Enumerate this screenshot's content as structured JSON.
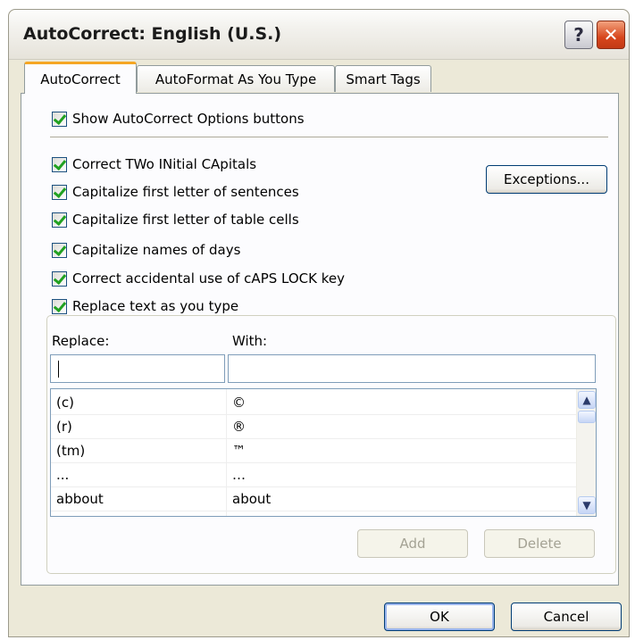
{
  "window": {
    "title": "AutoCorrect: English (U.S.)",
    "help_glyph": "?",
    "close_glyph": "✕",
    "colors": {
      "dialog_bg": "#ece9d8",
      "tab_highlight": "#f5a623",
      "check_green": "#21a121",
      "close_red": "#d7461c"
    }
  },
  "tabs": [
    {
      "label": "AutoCorrect",
      "active": true
    },
    {
      "label": "AutoFormat As You Type",
      "active": false
    },
    {
      "label": "Smart Tags",
      "active": false
    }
  ],
  "options": {
    "show_buttons": {
      "label": "Show AutoCorrect Options buttons",
      "checked": true
    },
    "two_initial_caps": {
      "label": "Correct TWo INitial CApitals",
      "checked": true
    },
    "cap_sentences": {
      "label": "Capitalize first letter of sentences",
      "checked": true
    },
    "cap_table_cells": {
      "label": "Capitalize first letter of table cells",
      "checked": true
    },
    "cap_days": {
      "label": "Capitalize names of days",
      "checked": true
    },
    "caps_lock": {
      "label": "Correct accidental use of cAPS LOCK key",
      "checked": true
    },
    "replace_text": {
      "label": "Replace text as you type",
      "checked": true
    }
  },
  "exceptions_button": "Exceptions...",
  "replace_section": {
    "replace_label": "Replace:",
    "with_label": "With:",
    "replace_value": "",
    "with_value": "",
    "entries": [
      {
        "replace": "(c)",
        "with": "©"
      },
      {
        "replace": "(r)",
        "with": "®"
      },
      {
        "replace": "(tm)",
        "with": "™"
      },
      {
        "replace": "...",
        "with": "…"
      },
      {
        "replace": "abbout",
        "with": "about"
      }
    ],
    "add_button": "Add",
    "delete_button": "Delete"
  },
  "footer": {
    "ok_button": "OK",
    "cancel_button": "Cancel"
  }
}
